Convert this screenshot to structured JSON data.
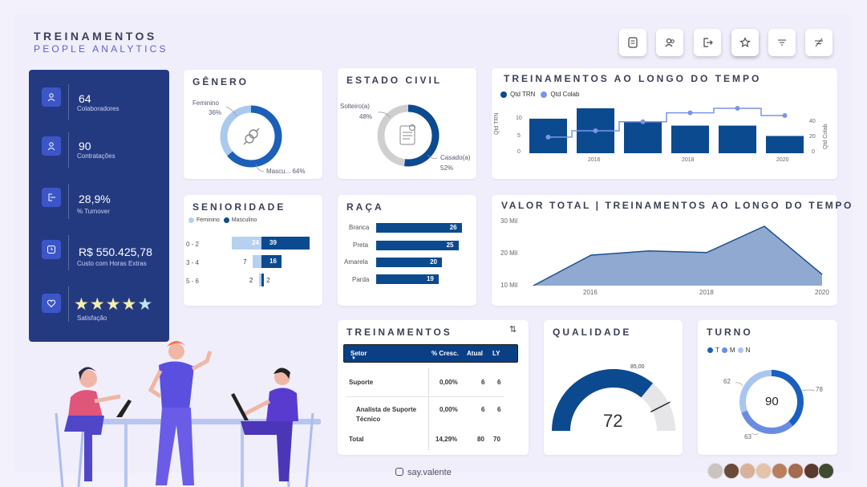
{
  "header": {
    "title": "TREINAMENTOS",
    "subtitle": "PEOPLE ANALYTICS"
  },
  "toolbar": [
    {
      "name": "report-icon"
    },
    {
      "name": "people-icon"
    },
    {
      "name": "exit-icon"
    },
    {
      "name": "star-icon"
    },
    {
      "name": "filter-icon"
    },
    {
      "name": "clear-filter-icon"
    }
  ],
  "kpis": [
    {
      "value": "64",
      "label": "Colaboradores",
      "icon": "user-icon"
    },
    {
      "value": "90",
      "label": "Contratações",
      "icon": "user-add-icon"
    },
    {
      "value": "28,9%",
      "label": "% Turnover",
      "icon": "exit-icon"
    },
    {
      "value": "R$ 550.425,78",
      "label": "Custo com Horas Extras",
      "icon": "clock-icon"
    },
    {
      "value": "★★★★★",
      "label": "Satisfação",
      "icon": "heart-icon",
      "stars": 4.5
    }
  ],
  "genero": {
    "title": "GÊNERO",
    "labels": {
      "fem": "Feminino",
      "fem_pct": "36%",
      "masc": "Mascu... 64%"
    },
    "chart_data": {
      "type": "pie",
      "categories": [
        "Feminino",
        "Masculino"
      ],
      "values": [
        36,
        64
      ]
    }
  },
  "estado_civil": {
    "title": "ESTADO CIVIL",
    "labels": {
      "solt": "Solteiro(a)",
      "solt_pct": "48%",
      "cas": "Casado(a)",
      "cas_pct": "52%"
    },
    "chart_data": {
      "type": "pie",
      "categories": [
        "Solteiro(a)",
        "Casado(a)"
      ],
      "values": [
        48,
        52
      ]
    }
  },
  "treinamentos_tempo": {
    "title": "TREINAMENTOS AO LONGO DO TEMPO",
    "legend": [
      "Qtd TRN",
      "Qtd Colab"
    ],
    "ylabel_left": "Qtd TRN",
    "ylabel_right": "Qtd Colab",
    "yticks_left": [
      "10",
      "5",
      "0"
    ],
    "yticks_right": [
      "40",
      "20",
      "0"
    ],
    "xticks": [
      "2016",
      "2018",
      "2020"
    ],
    "chart_data": {
      "type": "bar",
      "x": [
        2015,
        2016,
        2017,
        2018,
        2019,
        2020
      ],
      "series": [
        {
          "name": "Qtd TRN",
          "values": [
            10,
            13,
            9,
            8,
            8,
            5
          ]
        },
        {
          "name": "Qtd Colab",
          "values": [
            18,
            25,
            35,
            45,
            50,
            42
          ]
        }
      ],
      "ylim_left": [
        0,
        13
      ],
      "ylim_right": [
        0,
        50
      ]
    }
  },
  "senioridade": {
    "title": "SENIORIDADE",
    "legend": [
      "Feminino",
      "Masculino"
    ],
    "rows": [
      {
        "label": "0 - 2",
        "fem": "24",
        "masc": "39"
      },
      {
        "label": "3 - 4",
        "fem": "7",
        "masc": "16"
      },
      {
        "label": "5 - 6",
        "fem": "2",
        "masc": "2"
      }
    ],
    "chart_data": {
      "type": "bar",
      "categories": [
        "0 - 2",
        "3 - 4",
        "5 - 6"
      ],
      "series": [
        {
          "name": "Feminino",
          "values": [
            24,
            7,
            2
          ]
        },
        {
          "name": "Masculino",
          "values": [
            39,
            16,
            2
          ]
        }
      ]
    }
  },
  "raca": {
    "title": "RAÇA",
    "rows": [
      {
        "label": "Branca",
        "value": "26"
      },
      {
        "label": "Preta",
        "value": "25"
      },
      {
        "label": "Amarela",
        "value": "20"
      },
      {
        "label": "Parda",
        "value": "19"
      }
    ],
    "chart_data": {
      "type": "bar",
      "categories": [
        "Branca",
        "Preta",
        "Amarela",
        "Parda"
      ],
      "values": [
        26,
        25,
        20,
        19
      ]
    }
  },
  "valor_total": {
    "title": "VALOR TOTAL | TREINAMENTOS AO LONGO DO TEMPO",
    "yticks": [
      "30 Mil",
      "20 Mil",
      "10 Mil"
    ],
    "xticks": [
      "2016",
      "2018",
      "2020"
    ],
    "chart_data": {
      "type": "area",
      "x": [
        2015,
        2016,
        2017,
        2018,
        2019,
        2020
      ],
      "values": [
        10000,
        19500,
        20800,
        20300,
        28500,
        13500
      ],
      "ylim": [
        10000,
        30000
      ]
    }
  },
  "treinamentos_table": {
    "title": "TREINAMENTOS",
    "columns": [
      "Setor",
      "% Cresc.",
      "Atual",
      "LY"
    ],
    "rows": [
      {
        "setor": "Suporte",
        "cresc": "0,00%",
        "atual": "6",
        "ly": "6"
      },
      {
        "setor": "Analista de Suporte",
        "setor2": "Técnico",
        "cresc": "0,00%",
        "atual": "6",
        "ly": "6"
      }
    ],
    "total": {
      "setor": "Total",
      "cresc": "14,29%",
      "atual": "80",
      "ly": "70"
    }
  },
  "qualidade": {
    "title": "QUALIDADE",
    "target_label": "85,00",
    "value": "72",
    "chart_data": {
      "type": "gauge",
      "value": 72,
      "target": 85,
      "min": 0,
      "max": 100
    }
  },
  "turno": {
    "title": "TURNO",
    "legend": [
      "T",
      "M",
      "N"
    ],
    "center": "90",
    "labels": {
      "n": "62",
      "t": "78",
      "m": "63"
    },
    "chart_data": {
      "type": "pie",
      "categories": [
        "T",
        "M",
        "N"
      ],
      "values": [
        78,
        63,
        62
      ]
    }
  },
  "footer": {
    "handle": "say.valente"
  },
  "colors": {
    "dark_blue": "#0c4a8f",
    "mid_blue": "#1f66c6",
    "light_blue": "#a9c1ea",
    "sidebar": "#243a80",
    "accent": "#5a5fcf"
  }
}
